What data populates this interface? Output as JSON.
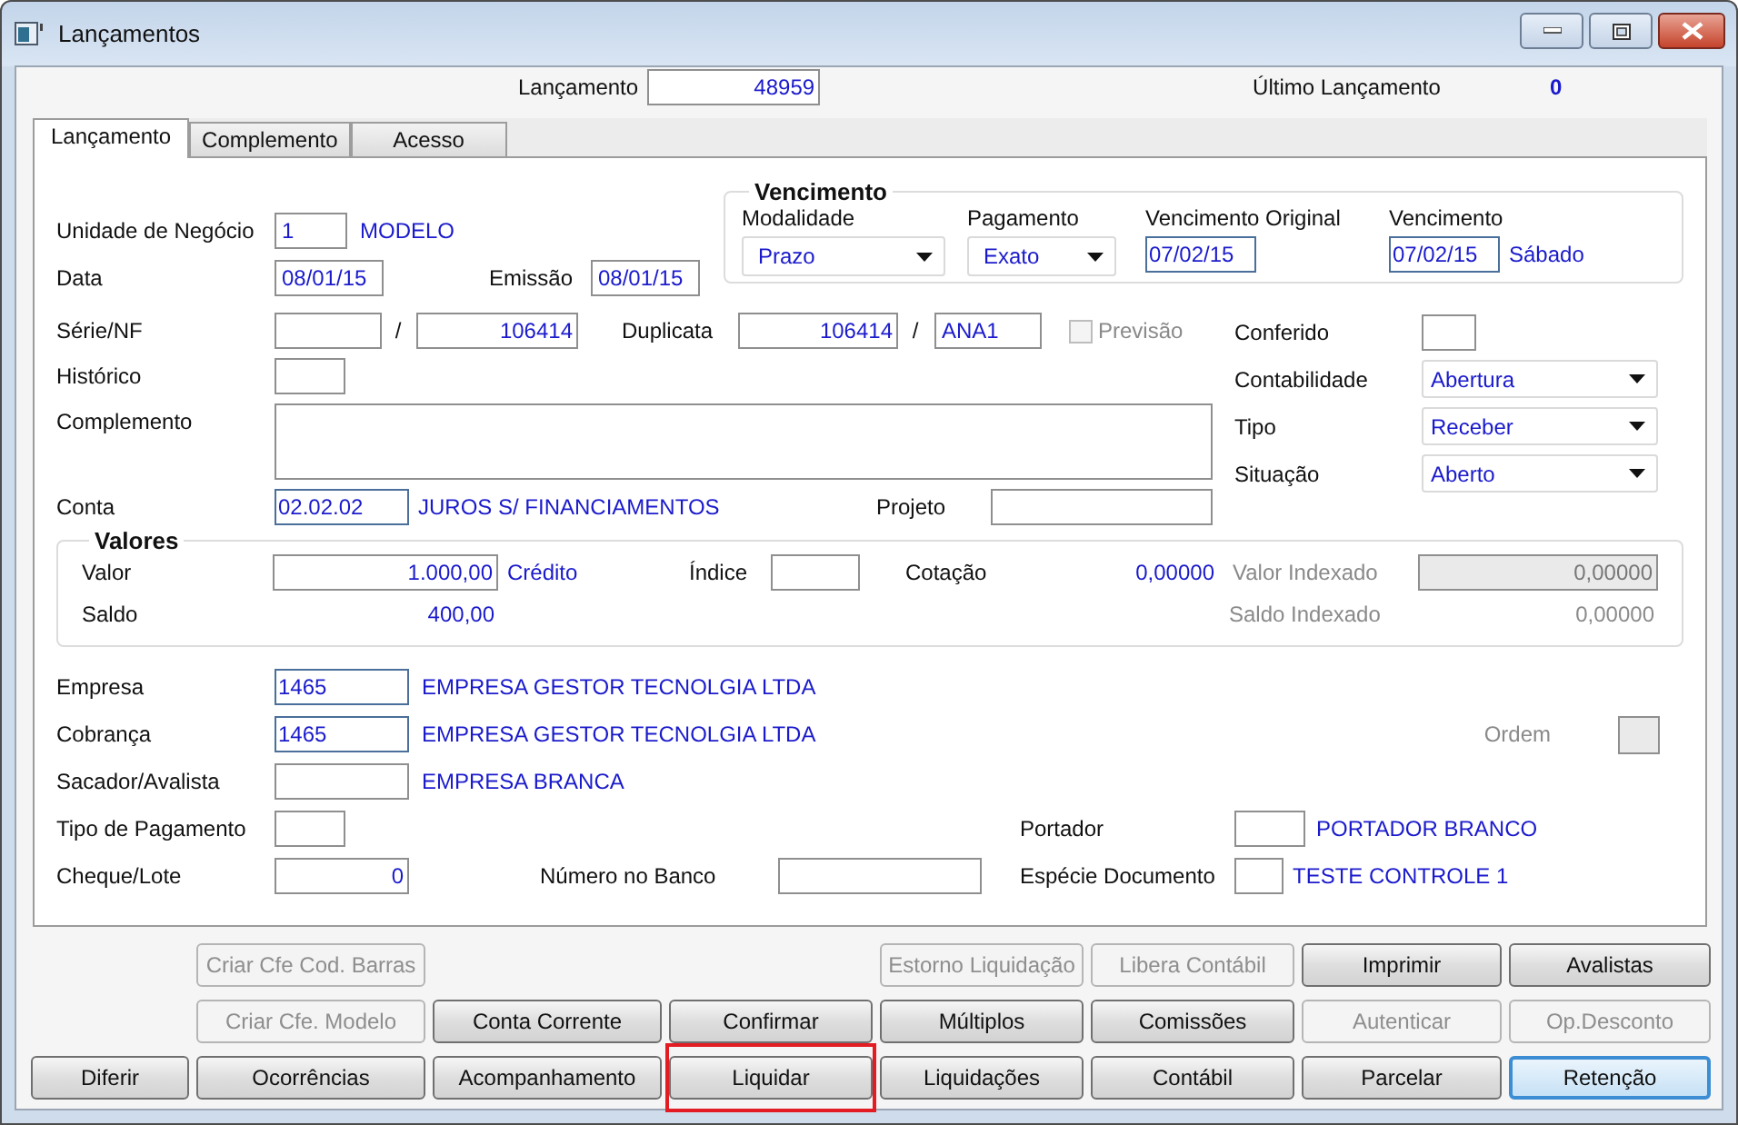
{
  "window": {
    "title": "Lançamentos"
  },
  "header": {
    "lancamento": {
      "label": "Lançamento",
      "value": "48959"
    },
    "ultimo_lancamento": {
      "label": "Último Lançamento",
      "value": "0"
    }
  },
  "tabs": [
    {
      "label": "Lançamento",
      "selected": true
    },
    {
      "label": "Complemento",
      "selected": false
    },
    {
      "label": "Acesso",
      "selected": false
    }
  ],
  "form": {
    "unidade": {
      "label": "Unidade de Negócio",
      "value": "1",
      "description": "MODELO"
    },
    "data": {
      "label": "Data",
      "value": "08/01/15"
    },
    "emissao": {
      "label": "Emissão",
      "value": "08/01/15"
    },
    "vencimento": {
      "title": "Vencimento",
      "modalidade": {
        "label": "Modalidade",
        "value": "Prazo"
      },
      "pagamento": {
        "label": "Pagamento",
        "value": "Exato"
      },
      "vencimento_original": {
        "label": "Vencimento Original",
        "value": "07/02/15"
      },
      "vencimento": {
        "label": "Vencimento",
        "value": "07/02/15",
        "weekday": "Sábado"
      }
    },
    "serie_nf": {
      "label": "Série/NF",
      "separator": "/",
      "nf": "106414"
    },
    "duplicata": {
      "label": "Duplicata",
      "value": "106414",
      "separator": "/",
      "suffix": "ANA1"
    },
    "previsao": {
      "label": "Previsão",
      "checked": false,
      "disabled": true
    },
    "conferido": {
      "label": "Conferido"
    },
    "historico": {
      "label": "Histórico"
    },
    "contabilidade": {
      "label": "Contabilidade",
      "value": "Abertura"
    },
    "complemento": {
      "label": "Complemento"
    },
    "tipo": {
      "label": "Tipo",
      "value": "Receber"
    },
    "situacao": {
      "label": "Situação",
      "value": "Aberto"
    },
    "conta": {
      "label": "Conta",
      "value": "02.02.02",
      "description": "JUROS S/ FINANCIAMENTOS"
    },
    "projeto": {
      "label": "Projeto"
    }
  },
  "valores": {
    "title": "Valores",
    "valor": {
      "label": "Valor",
      "value": "1.000,00",
      "type": "Crédito"
    },
    "indice": {
      "label": "Índice"
    },
    "cotacao": {
      "label": "Cotação",
      "value": "0,00000"
    },
    "valor_indexado": {
      "label": "Valor Indexado",
      "value": "0,00000",
      "disabled": true
    },
    "saldo": {
      "label": "Saldo",
      "value": "400,00"
    },
    "saldo_indexado": {
      "label": "Saldo Indexado",
      "value": "0,00000",
      "disabled": true
    }
  },
  "partes": {
    "empresa": {
      "label": "Empresa",
      "value": "1465",
      "description": "EMPRESA GESTOR TECNOLGIA LTDA"
    },
    "cobranca": {
      "label": "Cobrança",
      "value": "1465",
      "description": "EMPRESA GESTOR TECNOLGIA LTDA"
    },
    "ordem": {
      "label": "Ordem",
      "disabled": true
    },
    "sacador": {
      "label": "Sacador/Avalista",
      "description": "EMPRESA BRANCA"
    },
    "tipo_pagamento": {
      "label": "Tipo de Pagamento"
    },
    "portador": {
      "label": "Portador",
      "description": "PORTADOR BRANCO"
    },
    "cheque_lote": {
      "label": "Cheque/Lote",
      "value": "0"
    },
    "numero_banco": {
      "label": "Número no Banco"
    },
    "especie_documento": {
      "label": "Espécie Documento",
      "description": "TESTE CONTROLE 1"
    }
  },
  "button_columns": [
    [
      {
        "label": "Diferir",
        "disabled": false,
        "highlighted": false,
        "focused": false
      }
    ],
    [
      {
        "label": "Criar Cfe Cod. Barras",
        "disabled": true,
        "highlighted": false,
        "focused": false
      },
      {
        "label": "Criar Cfe. Modelo",
        "disabled": true,
        "highlighted": false,
        "focused": false
      },
      {
        "label": "Ocorrências",
        "disabled": false,
        "highlighted": false,
        "focused": false
      }
    ],
    [
      {
        "label": "Conta Corrente",
        "disabled": false,
        "highlighted": false,
        "focused": false
      },
      {
        "label": "Acompanhamento",
        "disabled": false,
        "highlighted": false,
        "focused": false
      }
    ],
    [
      {
        "label": "Confirmar",
        "disabled": false,
        "highlighted": false,
        "focused": false
      },
      {
        "label": "Liquidar",
        "disabled": false,
        "highlighted": true,
        "focused": false
      }
    ],
    [
      {
        "label": "Estorno Liquidação",
        "disabled": true,
        "highlighted": false,
        "focused": false
      },
      {
        "label": "Múltiplos",
        "disabled": false,
        "highlighted": false,
        "focused": false
      },
      {
        "label": "Liquidações",
        "disabled": false,
        "highlighted": false,
        "focused": false
      }
    ],
    [
      {
        "label": "Libera Contábil",
        "disabled": true,
        "highlighted": false,
        "focused": false
      },
      {
        "label": "Comissões",
        "disabled": false,
        "highlighted": false,
        "focused": false
      },
      {
        "label": "Contábil",
        "disabled": false,
        "highlighted": false,
        "focused": false
      }
    ],
    [
      {
        "label": "Imprimir",
        "disabled": false,
        "highlighted": false,
        "focused": false
      },
      {
        "label": "Autenticar",
        "disabled": true,
        "highlighted": false,
        "focused": false
      },
      {
        "label": "Parcelar",
        "disabled": false,
        "highlighted": false,
        "focused": false
      }
    ],
    [
      {
        "label": "Avalistas",
        "disabled": false,
        "highlighted": false,
        "focused": false
      },
      {
        "label": "Op.Desconto",
        "disabled": true,
        "highlighted": false,
        "focused": false
      },
      {
        "label": "Retenção",
        "disabled": false,
        "highlighted": false,
        "focused": true
      }
    ]
  ]
}
